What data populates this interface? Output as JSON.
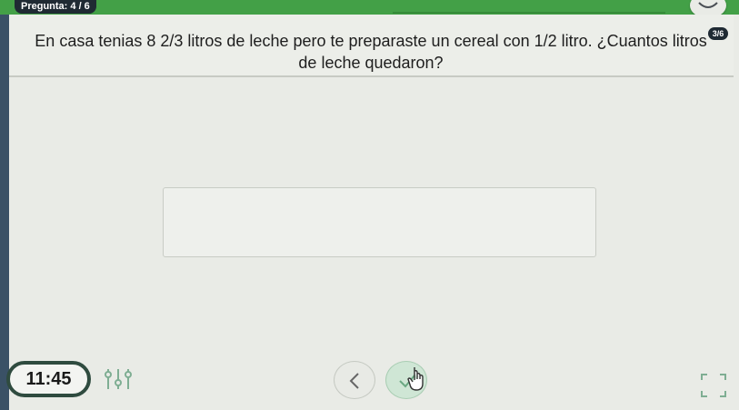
{
  "header": {
    "question_counter": "Pregunta: 4 / 6",
    "score_badge": "3/6"
  },
  "question": {
    "text": "En casa tenias 8 2/3 litros de leche pero te preparaste un cereal con 1/2 litro. ¿Cuantos litros de leche quedaron?"
  },
  "answer": {
    "value": ""
  },
  "footer": {
    "timer": "11:45",
    "icons": [
      "tools-icon",
      "chevron-left-icon",
      "check-icon",
      "fullscreen-icon"
    ]
  },
  "colors": {
    "accent": "#43a047",
    "timer_border": "#2f4b3f",
    "submit_bg": "#cfe6d5"
  }
}
